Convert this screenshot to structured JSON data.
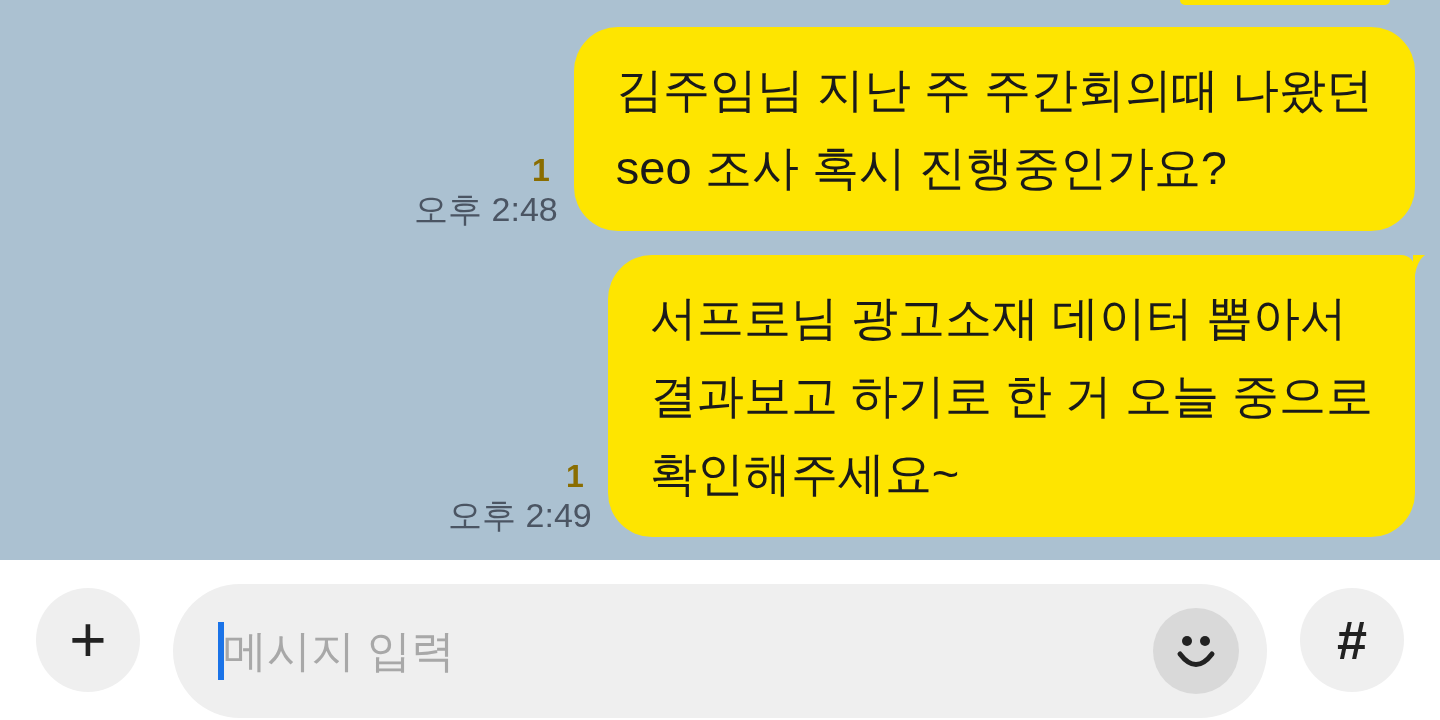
{
  "messages": [
    {
      "text": "김주임님 지난 주 주간회의때 나왔던\nseo 조사 혹시 진행중인가요?",
      "read_count": "1",
      "time": "오후 2:48",
      "tail": false
    },
    {
      "text": "서프로님 광고소재 데이터 뽑아서\n결과보고 하기로 한 거 오늘 중으로\n확인해주세요~",
      "read_count": "1",
      "time": "오후 2:49",
      "tail": true
    }
  ],
  "composer": {
    "attach": "+",
    "placeholder": "메시지 입력",
    "hash": "#"
  }
}
